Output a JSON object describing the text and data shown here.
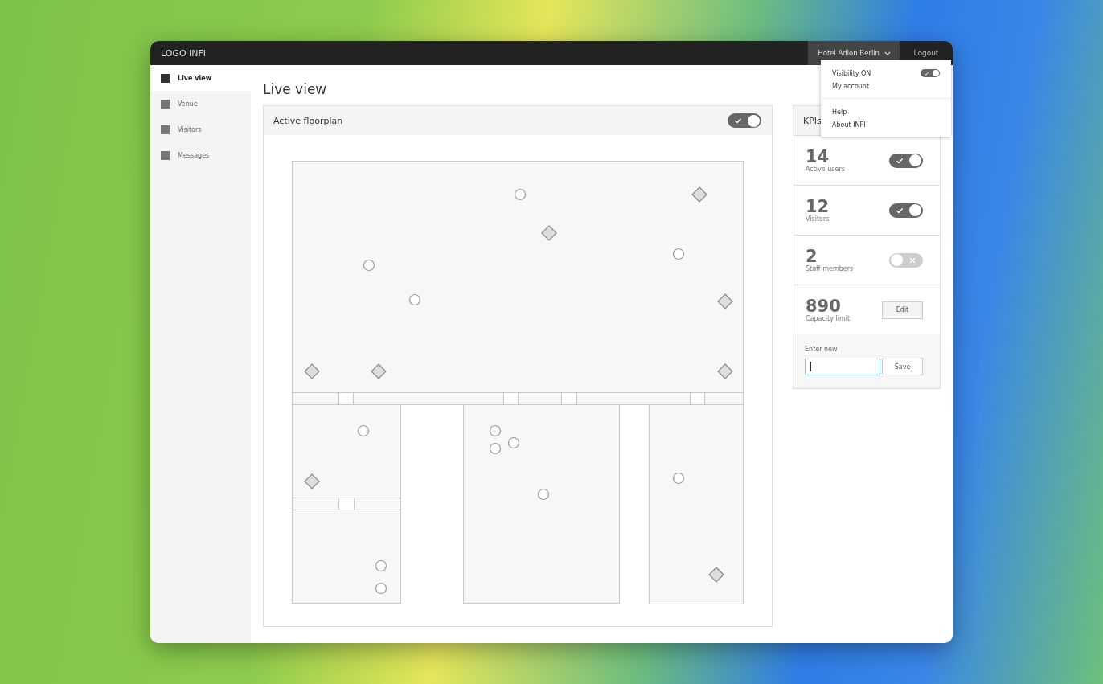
{
  "header": {
    "logo": "LOGO INFI",
    "venue": "Hotel Adlon Berlin",
    "logout": "Logout"
  },
  "dropdown": {
    "groups": [
      [
        {
          "kind": "toggle",
          "label": "Visibility ON",
          "on": true
        },
        {
          "kind": "link",
          "label": "My account"
        }
      ],
      [
        {
          "kind": "link",
          "label": "Help"
        },
        {
          "kind": "link",
          "label": "About INFI"
        }
      ]
    ]
  },
  "sidebar": {
    "items": [
      {
        "label": "Live view",
        "selected": true
      },
      {
        "label": "Venue",
        "selected": false
      },
      {
        "label": "Visitors",
        "selected": false
      },
      {
        "label": "Messages",
        "selected": false
      }
    ]
  },
  "page_title": "Live view",
  "floorplan_panel": {
    "title": "Active floorplan",
    "on": true
  },
  "kpis": {
    "title": "KPIs",
    "items": [
      {
        "kind": "toggle",
        "value": "14",
        "label": "Active users",
        "on": true
      },
      {
        "kind": "toggle",
        "value": "12",
        "label": "Visitors",
        "on": true
      },
      {
        "kind": "toggle",
        "value": "2",
        "label": "Staff members",
        "on": false
      },
      {
        "kind": "edit",
        "value": "890",
        "label": "Capacity limit",
        "button": "Edit"
      }
    ],
    "form": {
      "label": "Enter new",
      "focused": true,
      "button": "Save"
    }
  }
}
